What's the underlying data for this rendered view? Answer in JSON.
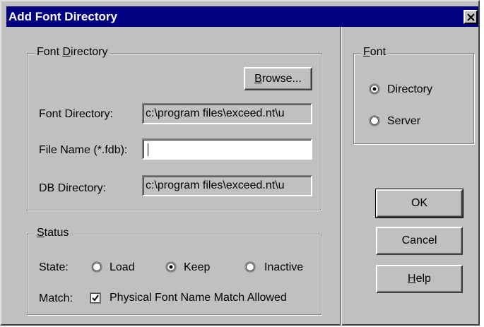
{
  "window": {
    "title": "Add Font Directory",
    "close_glyph": "close-icon"
  },
  "font_directory_group": {
    "legend": {
      "pre": "Font ",
      "access": "D",
      "post": "irectory"
    },
    "browse": {
      "access": "B",
      "post": "rowse..."
    },
    "font_directory_label": "Font Directory:",
    "font_directory_value": "c:\\program files\\exceed.nt\\u",
    "file_name_label": "File Name (*.fdb):",
    "file_name_value": "",
    "db_directory_label": "DB Directory:",
    "db_directory_value": "c:\\program files\\exceed.nt\\u"
  },
  "status_group": {
    "legend": {
      "access": "S",
      "post": "tatus"
    },
    "state_label": "State:",
    "state_options": [
      {
        "label": "Load",
        "selected": false
      },
      {
        "label": "Keep",
        "selected": true
      },
      {
        "label": "Inactive",
        "selected": false
      }
    ],
    "match_label": "Match:",
    "match_checkbox": {
      "label": "Physical Font Name Match Allowed",
      "checked": true
    }
  },
  "font_group": {
    "legend": {
      "access": "F",
      "post": "ont"
    },
    "options": [
      {
        "label": "Directory",
        "selected": true
      },
      {
        "label": "Server",
        "selected": false
      }
    ]
  },
  "buttons": {
    "ok": "OK",
    "cancel": "Cancel",
    "help": {
      "access": "H",
      "post": "elp"
    }
  },
  "colors": {
    "face": "#c0c0c0",
    "title_bar": "#000080",
    "title_text": "#ffffff"
  }
}
